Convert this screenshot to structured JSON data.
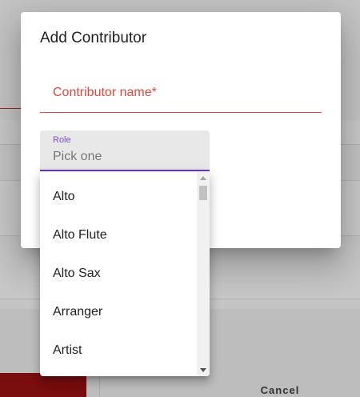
{
  "background": {
    "cancel_label": "Cancel",
    "partial_letter": "C"
  },
  "dialog": {
    "title": "Add Contributor",
    "name_field": {
      "label": "Contributor name*"
    },
    "role_field": {
      "label": "Role",
      "value": "Pick one"
    }
  },
  "menu": {
    "items": [
      {
        "label": "Alto"
      },
      {
        "label": "Alto Flute"
      },
      {
        "label": "Alto Sax"
      },
      {
        "label": "Arranger"
      },
      {
        "label": "Artist"
      }
    ]
  },
  "colors": {
    "error": "#e0473c",
    "accent": "#673ab7",
    "scrim": "#c4c4c4"
  }
}
